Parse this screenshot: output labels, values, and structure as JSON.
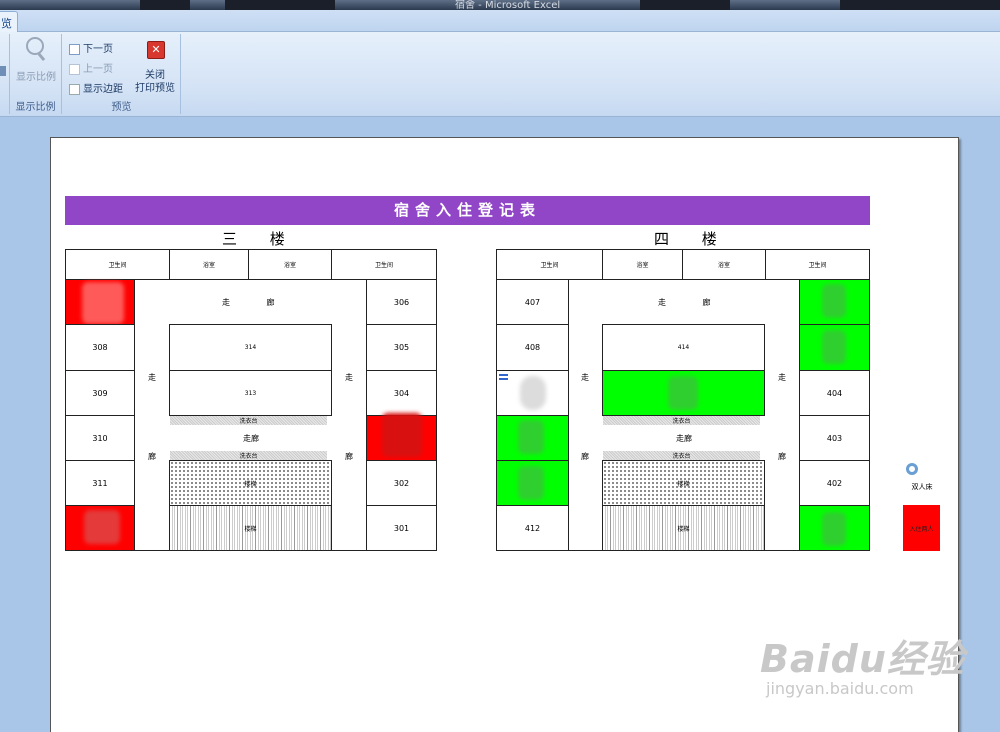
{
  "window": {
    "title": "宿舍 - Microsoft Excel"
  },
  "tabs": {
    "active": "览"
  },
  "ribbon": {
    "groups": [
      {
        "label": "显示比例",
        "buttons": [
          "显示比例"
        ]
      },
      {
        "label": "预览",
        "buttons": [
          "下一页",
          "上一页",
          "显示边距",
          "关闭打印预览"
        ]
      }
    ],
    "zoom_label": "显示比例",
    "zoom_group_label": "显示比例",
    "next_label": "下一页",
    "prev_label": "上一页",
    "margins_label": "显示边距",
    "close_label_1": "关闭",
    "close_label_2": "打印预览",
    "preview_group_label": "预览"
  },
  "sheet": {
    "title": "宿舍入住登记表",
    "colors": {
      "title_bg": "#9146c8",
      "occupied": "#ff0000",
      "vacant": "#00ff00"
    },
    "floor3": {
      "name": "三 楼",
      "top_cells": [
        "卫生间",
        "浴室",
        "浴室",
        "卫生间"
      ],
      "corridor": "走 廊",
      "side_corridor_top": "走",
      "side_corridor_bottom": "廊",
      "rooms_left": [
        "",
        "308",
        "309",
        "310",
        "311",
        ""
      ],
      "rooms_right": [
        "306",
        "305",
        "304",
        "",
        "302",
        "301"
      ],
      "center_rooms": [
        "314",
        "313"
      ],
      "strip_label": "洗衣台",
      "middle_corridor": "走廊",
      "stairs": "楼梯"
    },
    "floor4": {
      "name": "四 楼",
      "top_cells": [
        "卫生间",
        "浴室",
        "浴室",
        "卫生间"
      ],
      "corridor": "走 廊",
      "side_corridor_top": "走",
      "side_corridor_bottom": "廊",
      "rooms_left": [
        "407",
        "408",
        "",
        "",
        "",
        "412"
      ],
      "rooms_right": [
        "",
        "",
        "404",
        "403",
        "402",
        ""
      ],
      "center_rooms": [
        "414",
        ""
      ],
      "strip_label": "洗衣台",
      "middle_corridor": "走廊",
      "stairs": "楼梯"
    },
    "legend": {
      "label": "双人床",
      "occupied": "入住两人"
    }
  },
  "watermark": {
    "main": "Baidu经验",
    "sub": "jingyan.baidu.com"
  }
}
